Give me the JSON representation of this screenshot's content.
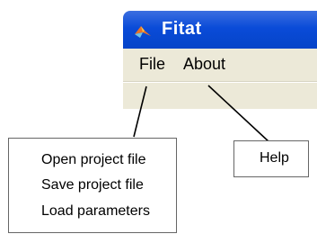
{
  "window": {
    "title": "Fitat",
    "menu": [
      "File",
      "About"
    ]
  },
  "file_menu": {
    "items": [
      "Open project file",
      "Save project file",
      "Load parameters"
    ]
  },
  "about_menu": {
    "items": [
      "Help"
    ]
  },
  "colors": {
    "titlebar": "#0a4bd8",
    "menubar": "#ece9d8"
  },
  "icons": [
    "matlab-logo-icon"
  ]
}
